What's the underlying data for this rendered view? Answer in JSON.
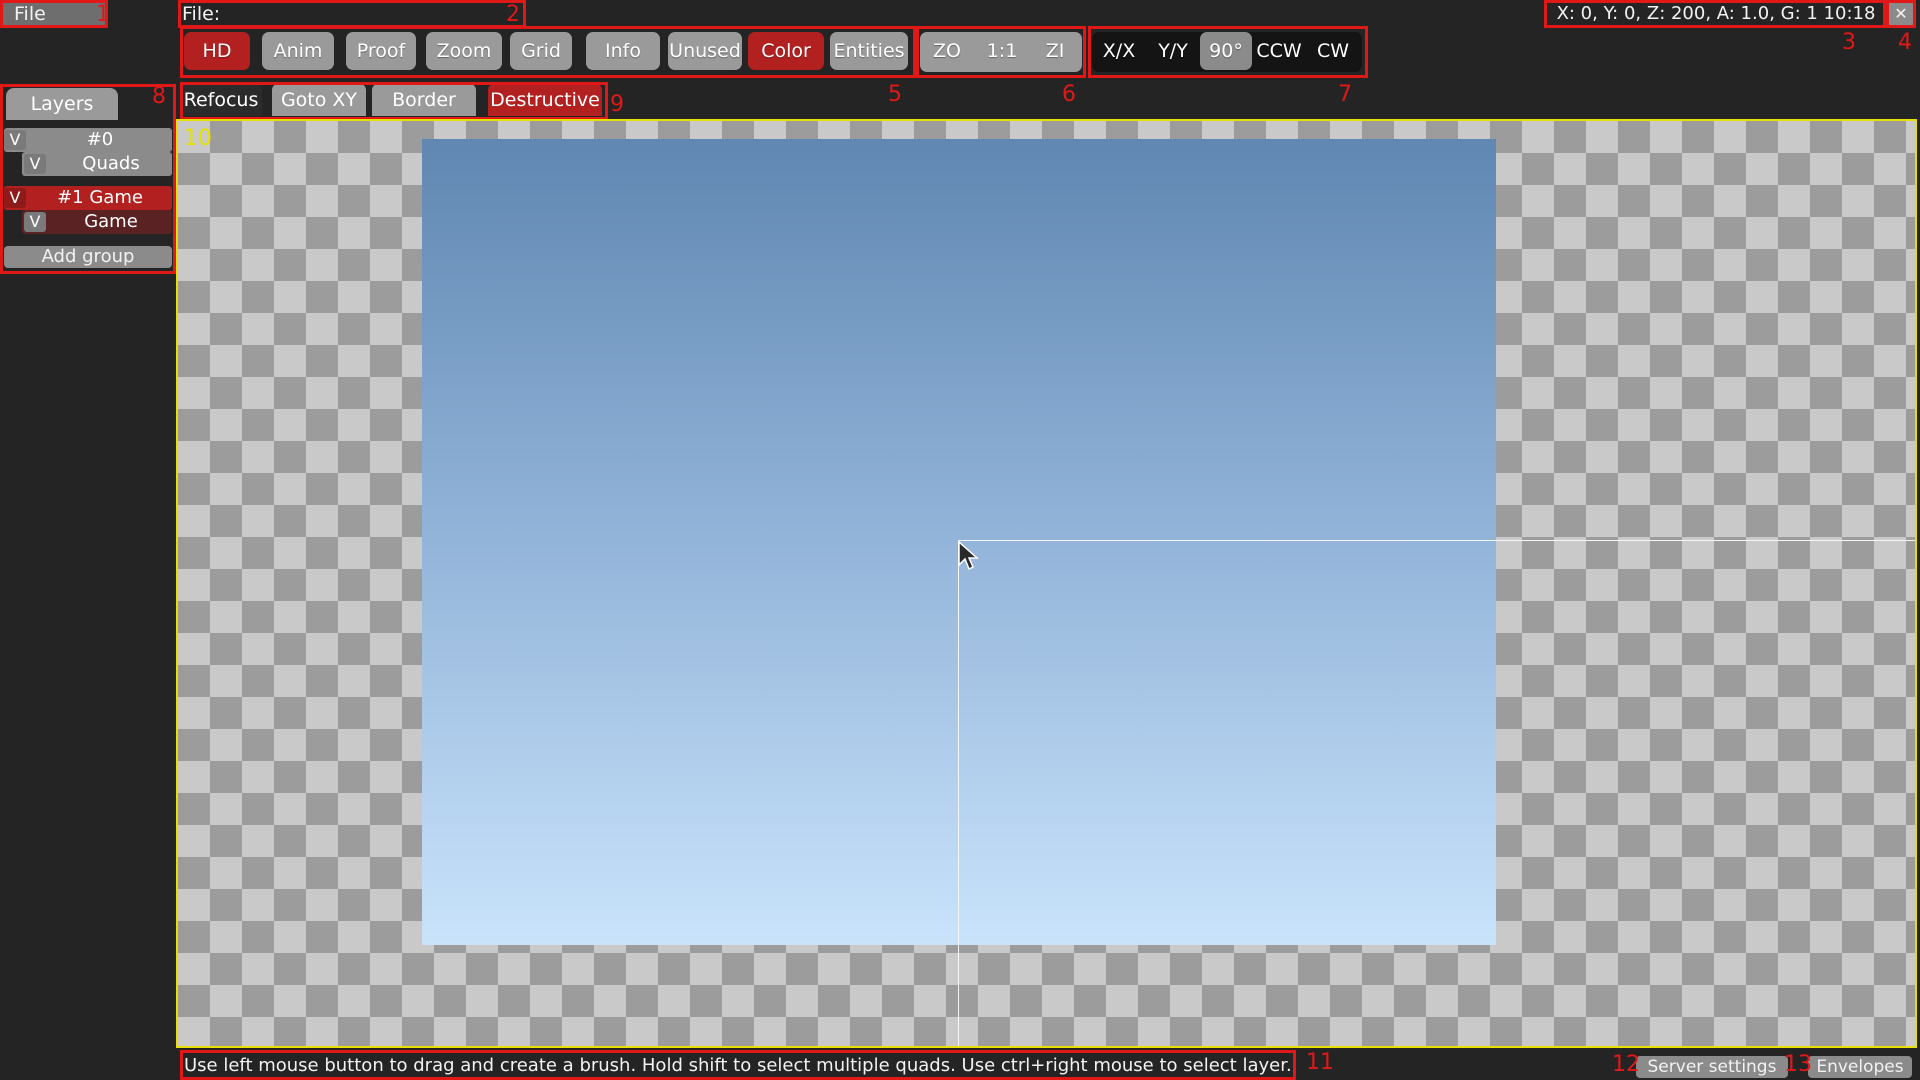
{
  "menu": {
    "file_label": "File"
  },
  "file_path": {
    "label": "File:"
  },
  "status_info": {
    "text": "X: 0, Y: 0, Z: 200, A: 1.0, G: 1  10:18"
  },
  "close_button": {
    "icon": "close-icon",
    "glyph": "✕"
  },
  "toolbar": {
    "main_buttons": [
      {
        "label": "HD",
        "active": true
      },
      {
        "label": "Anim",
        "active": false
      },
      {
        "label": "Proof",
        "active": false
      },
      {
        "label": "Zoom",
        "active": false
      },
      {
        "label": "Grid",
        "active": false
      },
      {
        "label": "Info",
        "active": false
      },
      {
        "label": "Unused",
        "active": false
      },
      {
        "label": "Color",
        "active": true
      },
      {
        "label": "Entities",
        "active": false
      }
    ],
    "zoom_buttons": [
      {
        "label": "ZO"
      },
      {
        "label": "1:1"
      },
      {
        "label": "ZI"
      }
    ],
    "transform_buttons": [
      {
        "label": "X/X"
      },
      {
        "label": "Y/Y"
      },
      {
        "label": "90°"
      },
      {
        "label": "CCW"
      },
      {
        "label": "CW"
      }
    ]
  },
  "quad_toolbar": {
    "buttons": [
      {
        "label": "Refocus"
      },
      {
        "label": "Goto XY"
      },
      {
        "label": "Border"
      },
      {
        "label": "Destructive",
        "active": true
      }
    ]
  },
  "layers_panel": {
    "tab_label": "Layers",
    "visibility_label": "V",
    "groups": [
      {
        "name": "#0",
        "layers": [
          {
            "name": "Quads"
          }
        ]
      },
      {
        "name": "#1 Game",
        "layers": [
          {
            "name": "Game"
          }
        ]
      }
    ],
    "add_group_label": "Add group"
  },
  "status_bar": {
    "hint": "Use left mouse button to drag and create a brush. Hold shift to select multiple quads. Use ctrl+right mouse to select layer.",
    "server_settings_label": "Server settings",
    "envelopes_label": "Envelopes"
  },
  "annotations": [
    "1",
    "2",
    "3",
    "4",
    "5",
    "6",
    "7",
    "8",
    "9",
    "10",
    "11",
    "12",
    "13"
  ],
  "colors": {
    "accent_red": "#b22020",
    "annotation_red": "#e11818",
    "canvas_border_yellow": "#e8e000",
    "background": "#242424"
  }
}
